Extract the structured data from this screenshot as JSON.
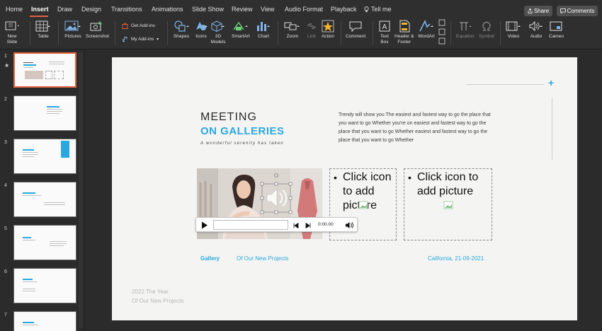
{
  "tabs": [
    {
      "label": "Home"
    },
    {
      "label": "Insert"
    },
    {
      "label": "Draw"
    },
    {
      "label": "Design"
    },
    {
      "label": "Transitions"
    },
    {
      "label": "Animations"
    },
    {
      "label": "Slide Show"
    },
    {
      "label": "Review"
    },
    {
      "label": "View"
    },
    {
      "label": "Audio Format"
    },
    {
      "label": "Playback"
    },
    {
      "label": "Tell me"
    }
  ],
  "active_tab": "Insert",
  "share_label": "Share",
  "comments_label": "Comments",
  "ribbon": {
    "new_slide": "New\nSlide",
    "table": "Table",
    "pictures": "Pictures",
    "screenshot": "Screenshot",
    "get_addins": "Get Add-ins",
    "my_addins": "My Add-ins",
    "shapes": "Shapes",
    "icons": "Icons",
    "models_3d": "3D\nModels",
    "smartart": "SmartArt",
    "chart": "Chart",
    "zoom": "Zoom",
    "link": "Link",
    "action": "Action",
    "comment": "Comment",
    "text_box": "Text\nBox",
    "header_footer": "Header &\nFooter",
    "wordart": "WordArt",
    "equation": "Equation",
    "symbol": "Symbol",
    "video": "Video",
    "audio": "Audio",
    "cameo": "Cameo"
  },
  "slides": [
    {
      "number": "1"
    },
    {
      "number": "2"
    },
    {
      "number": "3"
    },
    {
      "number": "4"
    },
    {
      "number": "5"
    },
    {
      "number": "6"
    },
    {
      "number": "7"
    }
  ],
  "slide": {
    "title_line1": "MEETING",
    "title_line2": "ON GALLERIES",
    "subtitle": "A wonderful serenity has taken",
    "body": "Trendy will show you The easiest and fastest way to go the place that you want to go Whether you're on easiest and fastest way to go the place that you want to go Whether easiest and fastest way to go the place that you want to go Whether",
    "placeholder1": "Click icon to add picture",
    "placeholder2": "Click icon to add picture",
    "media_time": "0:00.00",
    "gallery_label": "Gallery",
    "projects_label": "Of Our New Projects",
    "location_date": "California, 21-09-2021",
    "year_line1": "2022 The Year",
    "year_line2": "Of Our New Projects"
  },
  "colors": {
    "accent": "#29a8e0",
    "selection": "#e0633e"
  }
}
